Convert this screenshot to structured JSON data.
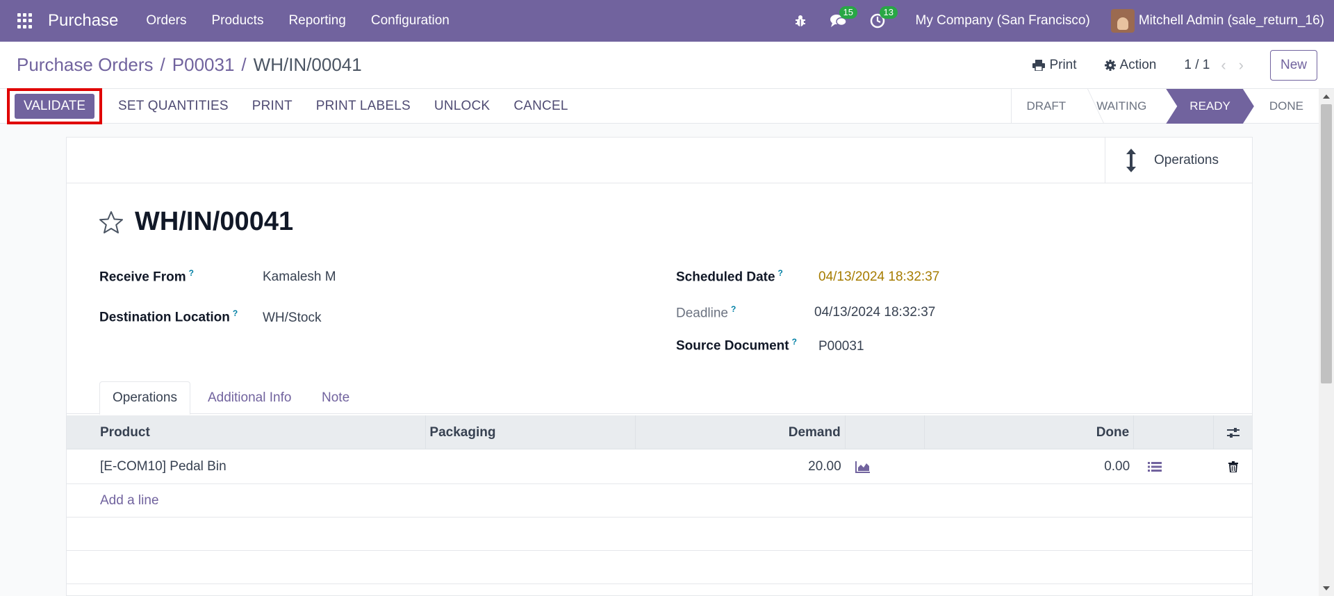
{
  "navbar": {
    "app_name": "Purchase",
    "menu": [
      "Orders",
      "Products",
      "Reporting",
      "Configuration"
    ],
    "messages_count": "15",
    "activities_count": "13",
    "company": "My Company (San Francisco)",
    "user": "Mitchell Admin (sale_return_16)"
  },
  "breadcrumb": {
    "items": [
      "Purchase Orders",
      "P00031"
    ],
    "current": "WH/IN/00041",
    "separator": "/"
  },
  "control": {
    "print_label": "Print",
    "action_label": "Action",
    "pager": "1 / 1",
    "new_label": "New"
  },
  "actions": {
    "validate": "VALIDATE",
    "set_quantities": "SET QUANTITIES",
    "print": "PRINT",
    "print_labels": "PRINT LABELS",
    "unlock": "UNLOCK",
    "cancel": "CANCEL"
  },
  "stages": [
    "DRAFT",
    "WAITING",
    "READY",
    "DONE"
  ],
  "active_stage": "READY",
  "smart_button": {
    "label": "Operations"
  },
  "record": {
    "title": "WH/IN/00041",
    "receive_from_label": "Receive From",
    "receive_from": "Kamalesh M",
    "destination_label": "Destination Location",
    "destination": "WH/Stock",
    "scheduled_date_label": "Scheduled Date",
    "scheduled_date": "04/13/2024 18:32:37",
    "deadline_label": "Deadline",
    "deadline": "04/13/2024 18:32:37",
    "source_document_label": "Source Document",
    "source_document": "P00031",
    "help_marker": "?"
  },
  "tabs": [
    "Operations",
    "Additional Info",
    "Note"
  ],
  "table": {
    "headers": {
      "product": "Product",
      "packaging": "Packaging",
      "demand": "Demand",
      "done": "Done"
    },
    "rows": [
      {
        "product": "[E-COM10] Pedal Bin",
        "packaging": "",
        "demand": "20.00",
        "done": "0.00"
      }
    ],
    "add_line": "Add a line"
  },
  "colors": {
    "brand": "#71639e",
    "validate_highlight": "#e00000",
    "badge": "#28a745",
    "warning_date": "#a67c00"
  }
}
